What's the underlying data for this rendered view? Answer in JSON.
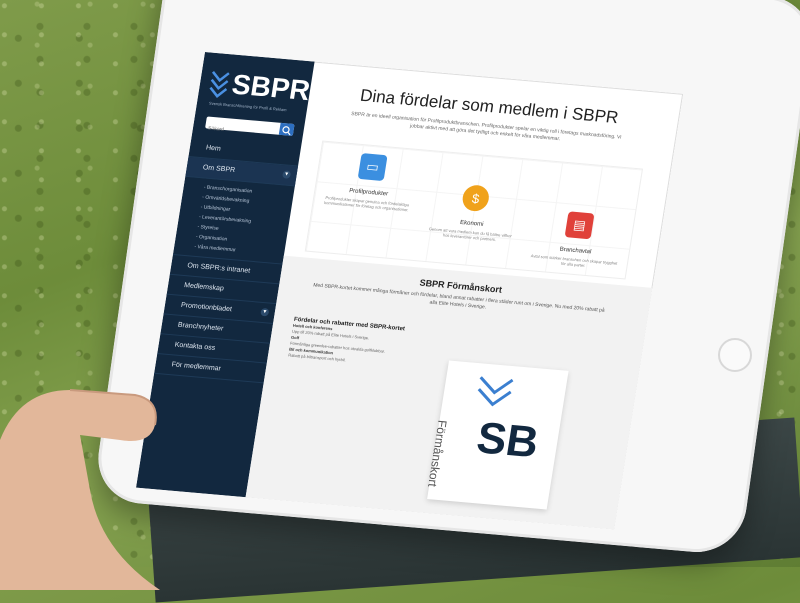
{
  "brand": {
    "name": "SBPR",
    "tagline": "Svensk Branschförening för Profil & Reklam"
  },
  "search": {
    "placeholder": "Sökord",
    "button_icon": "search-icon"
  },
  "nav": {
    "items": [
      {
        "label": "Hem"
      },
      {
        "label": "Om SBPR",
        "expanded": true
      },
      {
        "label": "Om SBPR:s intranet"
      },
      {
        "label": "Medlemskap"
      },
      {
        "label": "Promotionbladet"
      },
      {
        "label": "Branchnyheter"
      },
      {
        "label": "Kontakta oss"
      },
      {
        "label": "För medlemmar"
      }
    ],
    "subitems": [
      "- Branschorganisation",
      "- Omvärldsbevakning",
      "- Utbildningar",
      "- Leverantörsbevakning",
      "- Styrelse",
      "- Organisation",
      "- Våra medlemmar"
    ]
  },
  "main": {
    "title": "Dina fördelar som medlem i SBPR",
    "intro": "SBPR är en ideell organisation för Profilproduktbranschen. Profilprodukter spelar en viktig roll i företags marknadsföring. Vi jobbar aktivt med att göra det tydligt och enkelt för våra medlemmar."
  },
  "features": [
    {
      "title": "Profilprodukter",
      "icon": "credit-card-icon",
      "text": "Profilprodukter skapar genuina och fördelaktiga kommunikationer för företag och organisationer.",
      "color": "#3b8fe0"
    },
    {
      "title": "Ekonomi",
      "icon": "dollar-icon",
      "text": "Genom att vara medlem kan du få bättre villkor hos leverantörer och partners.",
      "color": "#f0a21b"
    },
    {
      "title": "Branchavtal",
      "icon": "document-icon",
      "text": "Avtal som stärker branschen och skapar trygghet för alla parter.",
      "color": "#e0413a"
    }
  ],
  "section2": {
    "title": "SBPR Förmånskort",
    "text": "Med SBPR-kortet kommer många förmåner och fördelar, bland annat rabatter i flera städer runt om i Sverige. Nu med 20% rabatt på alla Elite Hotels i Sverige.",
    "left_title": "Fördelar och rabatter med SBPR-kortet",
    "lines": [
      {
        "text": "Hotell och konferens",
        "bold": true
      },
      {
        "text": "Upp till 20% rabatt på Elite Hotels i Sverige.",
        "bold": false
      },
      {
        "text": "Golf",
        "bold": true
      },
      {
        "text": "Förmånliga greenfee-rabatter hos utvalda golfklubbar.",
        "bold": false
      },
      {
        "text": "Bil och kommunikation",
        "bold": true
      },
      {
        "text": "Rabatt på biltransport och hyrbil.",
        "bold": false
      }
    ],
    "card_big": "SB",
    "card_vertical": "Förmånskort"
  }
}
